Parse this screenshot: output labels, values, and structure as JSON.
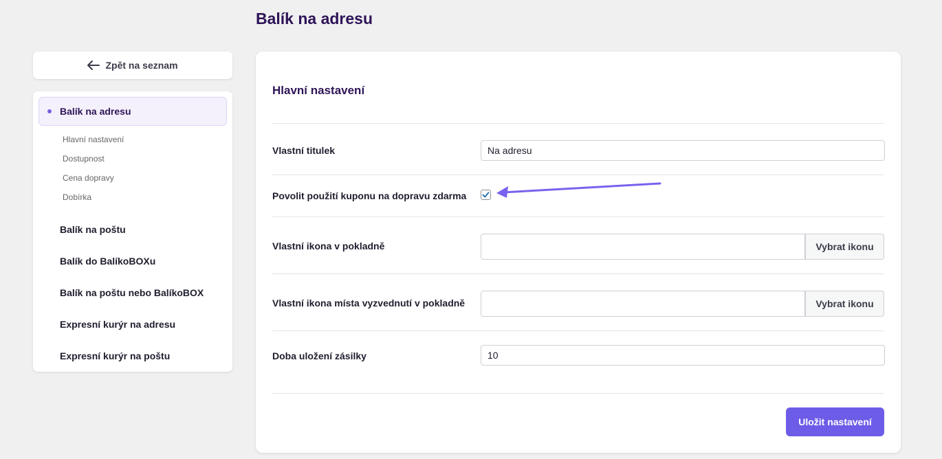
{
  "page": {
    "title": "Balík na adresu"
  },
  "back_button": {
    "label": "Zpět na seznam"
  },
  "sidebar": {
    "active": {
      "label": "Balík na adresu",
      "sub_items": [
        "Hlavní nastavení",
        "Dostupnost",
        "Cena dopravy",
        "Dobírka"
      ]
    },
    "items": [
      "Balík na poštu",
      "Balík do BalíkoBOXu",
      "Balík na poštu nebo BalíkoBOX",
      "Expresní kurýr na adresu",
      "Expresní kurýr na poštu"
    ]
  },
  "main": {
    "section_title": "Hlavní nastavení",
    "custom_title": {
      "label": "Vlastní titulek",
      "value": "Na adresu"
    },
    "free_shipping_coupon": {
      "label": "Povolit použití kuponu na dopravu zdarma",
      "checked": true
    },
    "checkout_icon": {
      "label": "Vlastní ikona v pokladně",
      "value": "",
      "button": "Vybrat ikonu"
    },
    "pickup_icon": {
      "label": "Vlastní ikona místa vyzvednutí v pokladně",
      "value": "",
      "button": "Vybrat ikonu"
    },
    "storage_time": {
      "label": "Doba uložení zásilky",
      "value": "10"
    },
    "save_button": "Uložit nastavení"
  },
  "colors": {
    "accent": "#6c5ce7",
    "title": "#2e1457",
    "annotation_arrow": "#7b61ee"
  }
}
